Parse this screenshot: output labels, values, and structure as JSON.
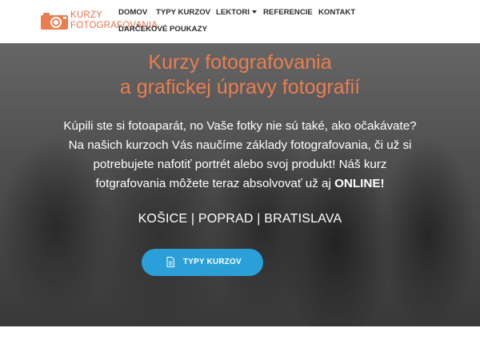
{
  "brand": {
    "line1": "KURZY",
    "line2": "FOTOGRAFOVANIA",
    "accent_color": "#ea7e4f",
    "logo_icon": "camera-icon"
  },
  "nav": {
    "items": [
      {
        "label": "DOMOV"
      },
      {
        "label": "TYPY KURZOV"
      },
      {
        "label": "LEKTORI",
        "has_dropdown": true
      },
      {
        "label": "REFERENCIE"
      },
      {
        "label": "KONTAKT"
      },
      {
        "label": "DARČEKOVÉ POUKAZY"
      }
    ]
  },
  "hero": {
    "title_line1": "Kurzy fotografovania",
    "title_line2": "a grafickej úpravy fotografií",
    "desc_lines": [
      "Kúpili ste si fotoaparát, no Vaše fotky nie sú také, ako očakávate?",
      "Na našich kurzoch Vás naučíme základy fotografovania, či už si",
      "potrebujete nafotiť portrét alebo svoj produkt! Náš kurz",
      "fotgrafovania môžete teraz absolvovať už aj"
    ],
    "desc_highlight": "ONLINE!",
    "cities": "KOŠICE | POPRAD | BRATISLAVA",
    "cta_label": "TYPY KURZOV",
    "cta_icon": "document-icon",
    "cta_color": "#2a9fd8"
  }
}
